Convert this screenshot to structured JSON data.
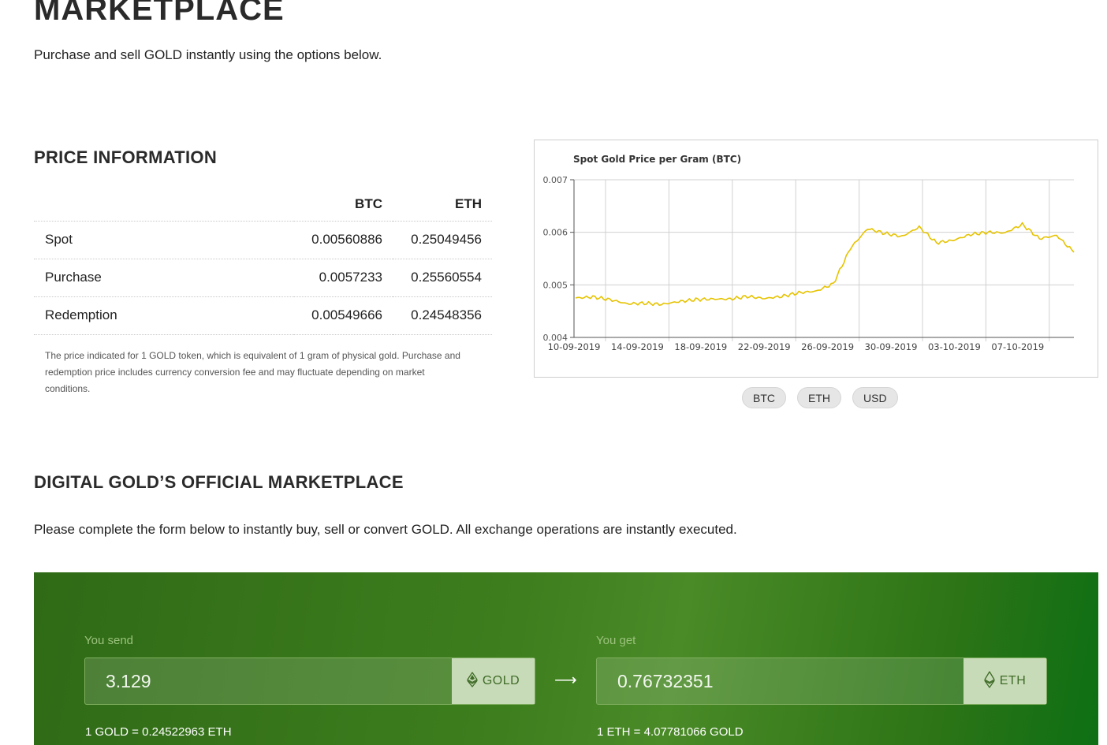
{
  "header": {
    "title": "MARKETPLACE",
    "subtitle": "Purchase and sell GOLD instantly using the options below."
  },
  "price_info": {
    "title": "PRICE INFORMATION",
    "columns": [
      "BTC",
      "ETH"
    ],
    "rows": [
      {
        "label": "Spot",
        "btc": "0.00560886",
        "eth": "0.25049456"
      },
      {
        "label": "Purchase",
        "btc": "0.0057233",
        "eth": "0.25560554"
      },
      {
        "label": "Redemption",
        "btc": "0.00549666",
        "eth": "0.24548356"
      }
    ],
    "note": "The price indicated for 1 GOLD token, which is equivalent of 1 gram of physical gold. Purchase and redemption price includes currency conversion fee and may fluctuate depending on market conditions."
  },
  "chart_data": {
    "type": "line",
    "title": "Spot Gold Price per Gram (BTC)",
    "xlabel": "",
    "ylabel": "",
    "ylim": [
      0.004,
      0.007
    ],
    "yticks": [
      "0.007",
      "0.006",
      "0.005",
      "0.004"
    ],
    "x_tick_labels": [
      "10-09-2019",
      "14-09-2019",
      "18-09-2019",
      "22-09-2019",
      "26-09-2019",
      "30-09-2019",
      "03-10-2019",
      "07-10-2019"
    ],
    "grid": true,
    "line_color": "#e6c300",
    "series": [
      {
        "x": [
          "10-09-2019",
          "11-09-2019",
          "12-09-2019",
          "13-09-2019",
          "14-09-2019",
          "15-09-2019",
          "16-09-2019",
          "17-09-2019",
          "18-09-2019",
          "19-09-2019",
          "20-09-2019",
          "21-09-2019",
          "22-09-2019",
          "23-09-2019",
          "24-09-2019",
          "25-09-2019",
          "26-09-2019",
          "27-09-2019",
          "28-09-2019",
          "29-09-2019",
          "30-09-2019",
          "01-10-2019",
          "02-10-2019",
          "03-10-2019",
          "04-10-2019",
          "05-10-2019",
          "06-10-2019",
          "07-10-2019",
          "08-10-2019",
          "09-10-2019"
        ],
        "values": [
          0.00475,
          0.00477,
          0.00472,
          0.00464,
          0.00465,
          0.00463,
          0.00468,
          0.00472,
          0.00473,
          0.00473,
          0.00478,
          0.00474,
          0.00478,
          0.00485,
          0.00488,
          0.00502,
          0.0057,
          0.00607,
          0.00598,
          0.00592,
          0.0061,
          0.0058,
          0.00585,
          0.00596,
          0.006,
          0.00599,
          0.00615,
          0.00588,
          0.00594,
          0.00562
        ]
      }
    ]
  },
  "chart_buttons": [
    "BTC",
    "ETH",
    "USD"
  ],
  "marketplace": {
    "title": "DIGITAL GOLD’S OFFICIAL MARKETPLACE",
    "description": "Please complete the form below to instantly buy, sell or convert GOLD. All exchange operations are instantly executed."
  },
  "exchange": {
    "send_label": "You send",
    "send_value": "3.129",
    "send_currency": "GOLD",
    "send_rate": "1 GOLD = 0.24522963 ETH",
    "get_label": "You get",
    "get_value": "0.76732351",
    "get_currency": "ETH",
    "get_rate": "1 ETH = 4.07781066 GOLD",
    "arrow": "⟶"
  }
}
